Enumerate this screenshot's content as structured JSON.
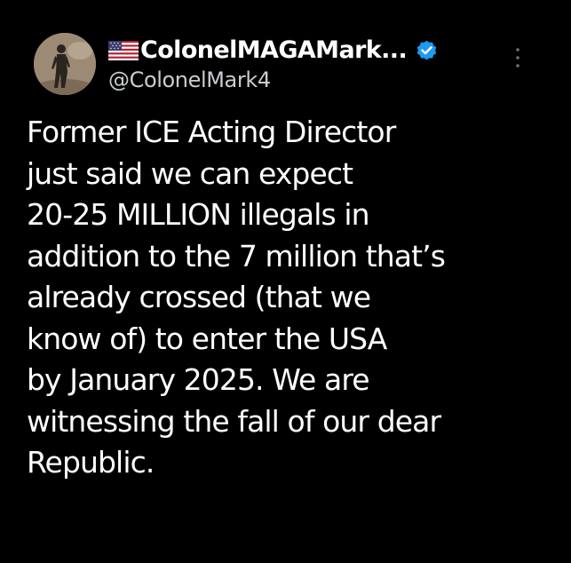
{
  "colors": {
    "background": "#000000",
    "text": "#ffffff",
    "handle_text": "#c9cdd1",
    "verified_badge": "#1d9bf0"
  },
  "author": {
    "flag_icon": "us-flag-icon",
    "display_name": "ColonelMAGAMark...",
    "verified_icon": "verified-badge-icon",
    "handle": "@ColonelMark4",
    "more_icon": "more-options-icon"
  },
  "tweet": {
    "lines": [
      "Former ICE Acting Director",
      "just said we can expect",
      "20-25 MILLION illegals in",
      "addition to the 7 million that’s",
      "already crossed (that we",
      "know of) to enter the USA",
      "by January 2025. We are",
      "witnessing the fall of our dear",
      "Republic."
    ]
  }
}
